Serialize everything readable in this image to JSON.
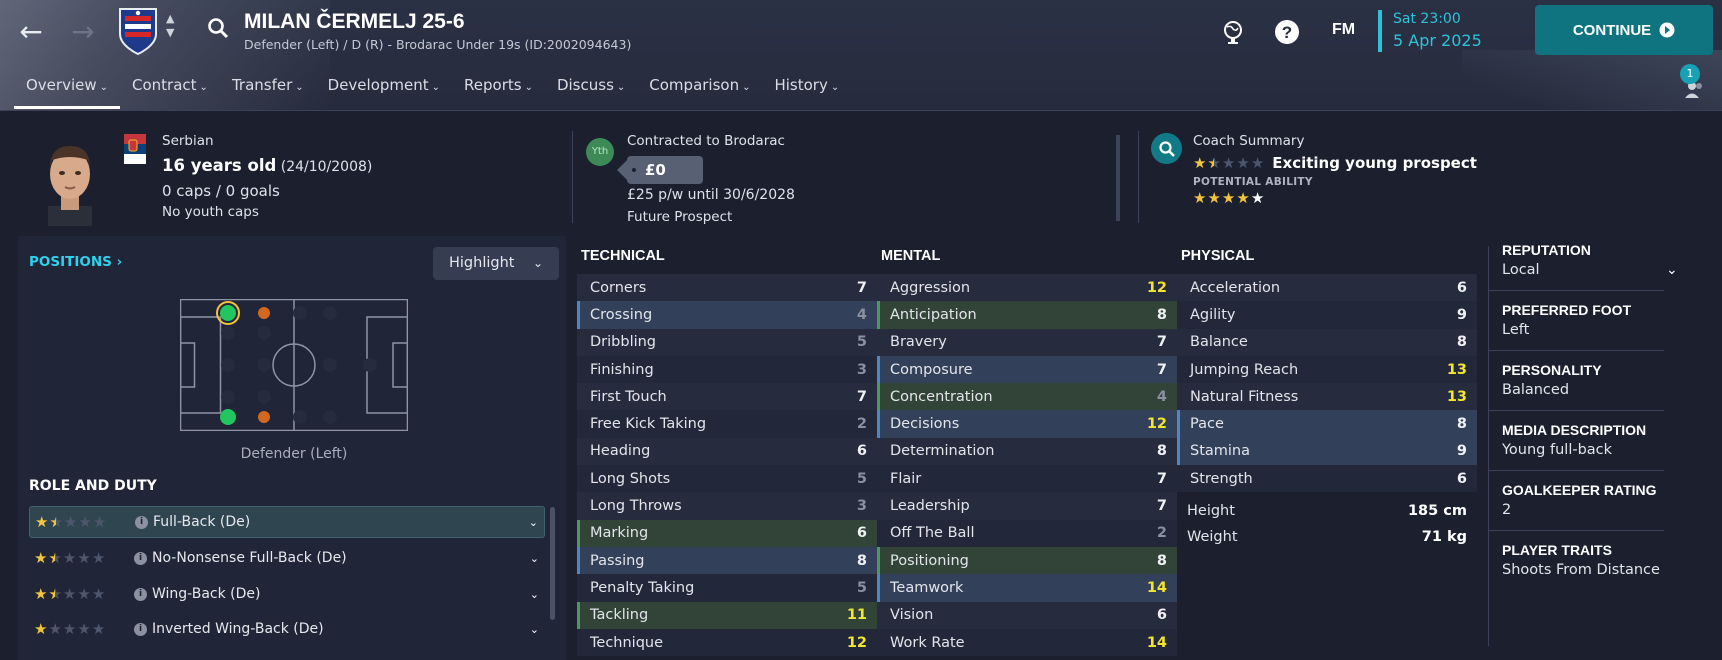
{
  "header": {
    "player_name": "MILAN ČERMELJ 25-6",
    "subtitle": "Defender (Left) / D (R) - Brodarac Under 19s (ID:2002094643)",
    "fm_label": "FM",
    "date_time": "Sat 23:00",
    "date": "5 Apr 2025",
    "continue_label": "CONTINUE",
    "notif_count": "1",
    "tabs": [
      {
        "label": "Overview",
        "active": true
      },
      {
        "label": "Contract"
      },
      {
        "label": "Transfer"
      },
      {
        "label": "Development"
      },
      {
        "label": "Reports"
      },
      {
        "label": "Discuss"
      },
      {
        "label": "Comparison"
      },
      {
        "label": "History"
      }
    ]
  },
  "summary": {
    "nationality": "Serbian",
    "age": "16 years old",
    "dob": "(24/10/2008)",
    "caps": "0 caps / 0 goals",
    "youth_caps": "No youth caps",
    "yth_badge": "Yth",
    "contracted_to": "Contracted to Brodarac",
    "value": "£0",
    "wage": "£25 p/w until 30/6/2028",
    "prospect": "Future Prospect",
    "coach_label": "Coach Summary",
    "coach_text": "Exciting young prospect",
    "potential_label": "POTENTIAL ABILITY",
    "current_ability_stars": 1.5,
    "potential_ability_stars": 4.5
  },
  "positions": {
    "link": "POSITIONS",
    "highlight_label": "Highlight",
    "position_label": "Defender (Left)",
    "role_header": "ROLE AND DUTY",
    "roles": [
      {
        "label": "Full-Back (De)",
        "stars": 1.5,
        "selected": true
      },
      {
        "label": "No-Nonsense Full-Back (De)",
        "stars": 1.5
      },
      {
        "label": "Wing-Back (De)",
        "stars": 1.5
      },
      {
        "label": "Inverted Wing-Back (De)",
        "stars": 1
      }
    ]
  },
  "attributes": {
    "technical_header": "TECHNICAL",
    "mental_header": "MENTAL",
    "physical_header": "PHYSICAL",
    "technical": [
      {
        "name": "Corners",
        "value": "7"
      },
      {
        "name": "Crossing",
        "value": "4",
        "hl": "b"
      },
      {
        "name": "Dribbling",
        "value": "5"
      },
      {
        "name": "Finishing",
        "value": "3"
      },
      {
        "name": "First Touch",
        "value": "7"
      },
      {
        "name": "Free Kick Taking",
        "value": "2"
      },
      {
        "name": "Heading",
        "value": "6"
      },
      {
        "name": "Long Shots",
        "value": "5"
      },
      {
        "name": "Long Throws",
        "value": "3"
      },
      {
        "name": "Marking",
        "value": "6",
        "hl": "g"
      },
      {
        "name": "Passing",
        "value": "8",
        "hl": "b"
      },
      {
        "name": "Penalty Taking",
        "value": "5"
      },
      {
        "name": "Tackling",
        "value": "11",
        "hl": "g"
      },
      {
        "name": "Technique",
        "value": "12"
      }
    ],
    "mental": [
      {
        "name": "Aggression",
        "value": "12"
      },
      {
        "name": "Anticipation",
        "value": "8",
        "hl": "g"
      },
      {
        "name": "Bravery",
        "value": "7"
      },
      {
        "name": "Composure",
        "value": "7",
        "hl": "b"
      },
      {
        "name": "Concentration",
        "value": "4",
        "hl": "g"
      },
      {
        "name": "Decisions",
        "value": "12",
        "hl": "b"
      },
      {
        "name": "Determination",
        "value": "8"
      },
      {
        "name": "Flair",
        "value": "7"
      },
      {
        "name": "Leadership",
        "value": "7"
      },
      {
        "name": "Off The Ball",
        "value": "2"
      },
      {
        "name": "Positioning",
        "value": "8",
        "hl": "g"
      },
      {
        "name": "Teamwork",
        "value": "14",
        "hl": "b"
      },
      {
        "name": "Vision",
        "value": "6"
      },
      {
        "name": "Work Rate",
        "value": "14"
      }
    ],
    "physical": [
      {
        "name": "Acceleration",
        "value": "6"
      },
      {
        "name": "Agility",
        "value": "9"
      },
      {
        "name": "Balance",
        "value": "8"
      },
      {
        "name": "Jumping Reach",
        "value": "13"
      },
      {
        "name": "Natural Fitness",
        "value": "13"
      },
      {
        "name": "Pace",
        "value": "8",
        "hl": "b"
      },
      {
        "name": "Stamina",
        "value": "9",
        "hl": "b"
      },
      {
        "name": "Strength",
        "value": "6"
      }
    ],
    "height_label": "Height",
    "height": "185 cm",
    "weight_label": "Weight",
    "weight": "71 kg"
  },
  "info": [
    {
      "label": "REPUTATION",
      "value": "Local"
    },
    {
      "label": "PREFERRED FOOT",
      "value": "Left"
    },
    {
      "label": "PERSONALITY",
      "value": "Balanced"
    },
    {
      "label": "MEDIA DESCRIPTION",
      "value": "Young full-back"
    },
    {
      "label": "GOALKEEPER RATING",
      "value": "2"
    },
    {
      "label": "PLAYER TRAITS",
      "value": "Shoots From Distance"
    }
  ],
  "colors": {
    "accent": "#2cc3da",
    "continue_bg": "#0f7480",
    "star": "#f2c53d",
    "highlight_value": "#f3e62c",
    "natural_position": "#22c55e",
    "secondary_position": "#d2691e"
  }
}
